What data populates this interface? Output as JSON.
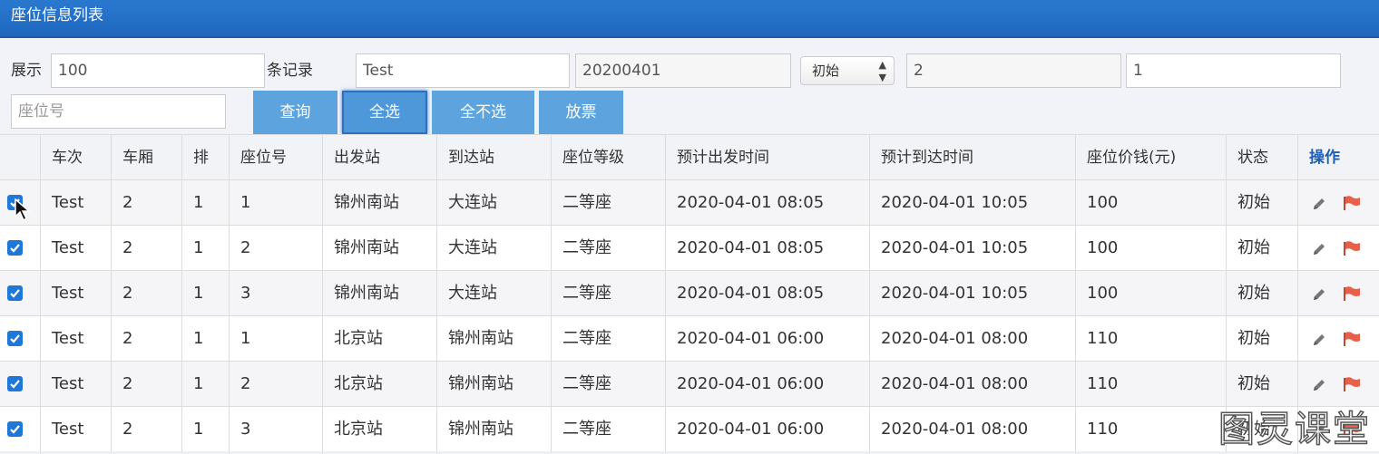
{
  "header": {
    "title": "座位信息列表"
  },
  "filters": {
    "show_label": "展示",
    "page_size_value": "100",
    "records_label": "条记录",
    "train_value": "Test",
    "date_value": "20200401",
    "status_select": "初始",
    "carriage_value": "2",
    "row_value": "1",
    "seat_placeholder": "座位号"
  },
  "buttons": {
    "query": "查询",
    "select_all": "全选",
    "select_none": "全不选",
    "release": "放票"
  },
  "table": {
    "columns": [
      "车次",
      "车厢",
      "排",
      "座位号",
      "出发站",
      "到达站",
      "座位等级",
      "预计出发时间",
      "预计到达时间",
      "座位价钱(元)",
      "状态",
      "操作"
    ],
    "rows": [
      [
        "Test",
        "2",
        "1",
        "1",
        "锦州南站",
        "大连站",
        "二等座",
        "2020-04-01 08:05",
        "2020-04-01 10:05",
        "100",
        "初始"
      ],
      [
        "Test",
        "2",
        "1",
        "2",
        "锦州南站",
        "大连站",
        "二等座",
        "2020-04-01 08:05",
        "2020-04-01 10:05",
        "100",
        "初始"
      ],
      [
        "Test",
        "2",
        "1",
        "3",
        "锦州南站",
        "大连站",
        "二等座",
        "2020-04-01 08:05",
        "2020-04-01 10:05",
        "100",
        "初始"
      ],
      [
        "Test",
        "2",
        "1",
        "1",
        "北京站",
        "锦州南站",
        "二等座",
        "2020-04-01 06:00",
        "2020-04-01 08:00",
        "110",
        "初始"
      ],
      [
        "Test",
        "2",
        "1",
        "2",
        "北京站",
        "锦州南站",
        "二等座",
        "2020-04-01 06:00",
        "2020-04-01 08:00",
        "110",
        "初始"
      ],
      [
        "Test",
        "2",
        "1",
        "3",
        "北京站",
        "锦州南站",
        "二等座",
        "2020-04-01 06:00",
        "2020-04-01 08:00",
        "110",
        "初始"
      ]
    ],
    "row_icons": [
      "pencil-icon",
      "flag-icon"
    ]
  },
  "watermark": "图灵课堂",
  "colors": {
    "header": "#1e67bf",
    "button": "#5da4de",
    "checkbox": "#1f78d8",
    "flag": "#e8604a",
    "op_header": "#1f5fb8"
  }
}
